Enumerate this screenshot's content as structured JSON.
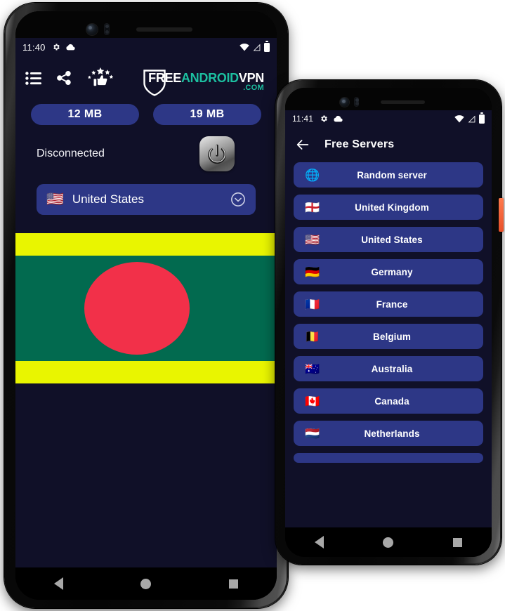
{
  "phone1": {
    "status_bar": {
      "time": "11:40",
      "left_icons": [
        "gear-icon",
        "cloud-icon"
      ],
      "right_icons": [
        "wifi-icon",
        "signal-icon",
        "battery-icon"
      ]
    },
    "toolbar": {
      "icons": [
        {
          "name": "list-icon",
          "label": "List"
        },
        {
          "name": "share-icon",
          "label": "Share"
        },
        {
          "name": "rate-icon",
          "label": "Rate"
        }
      ]
    },
    "logo": {
      "part1": "FREE",
      "part2": "ANDROID",
      "part3": "VPN",
      "part4": ".COM",
      "color_white": "#ffffff",
      "color_teal": "#1cbfa0"
    },
    "stats": {
      "download": "12 MB",
      "upload": "19 MB"
    },
    "connection_status": "Disconnected",
    "power_button_label": "Power",
    "server_selector": {
      "flag": "🇺🇸",
      "label": "United States",
      "chevron": "chevron-down-icon"
    },
    "banner": {
      "flag_name": "Bangladesh",
      "bar_color": "#e9f500",
      "field_color": "#026a4f",
      "disc_color": "#f23049"
    },
    "nav": [
      "back-button",
      "home-button",
      "recents-button"
    ]
  },
  "phone2": {
    "status_bar": {
      "time": "11:41",
      "left_icons": [
        "gear-icon",
        "cloud-icon"
      ],
      "right_icons": [
        "wifi-icon",
        "signal-icon",
        "battery-icon"
      ]
    },
    "header": {
      "back": "back-arrow-icon",
      "title": "Free Servers"
    },
    "servers": [
      {
        "flag": "🌐",
        "name": "Random server"
      },
      {
        "flag": "🏴󠁧󠁢󠁥󠁮󠁧󠁿",
        "name": "United Kingdom"
      },
      {
        "flag": "🇺🇸",
        "name": "United States"
      },
      {
        "flag": "🇩🇪",
        "name": "Germany"
      },
      {
        "flag": "🇫🇷",
        "name": "France"
      },
      {
        "flag": "🇧🇪",
        "name": "Belgium"
      },
      {
        "flag": "🇦🇺",
        "name": "Australia"
      },
      {
        "flag": "🇨🇦",
        "name": "Canada"
      },
      {
        "flag": "🇳🇱",
        "name": "Netherlands"
      }
    ],
    "nav": [
      "back-button",
      "home-button",
      "recents-button"
    ]
  },
  "theme": {
    "app_background": "#101028",
    "card_blue": "#2d3786",
    "accent_teal": "#1cbfa0"
  }
}
